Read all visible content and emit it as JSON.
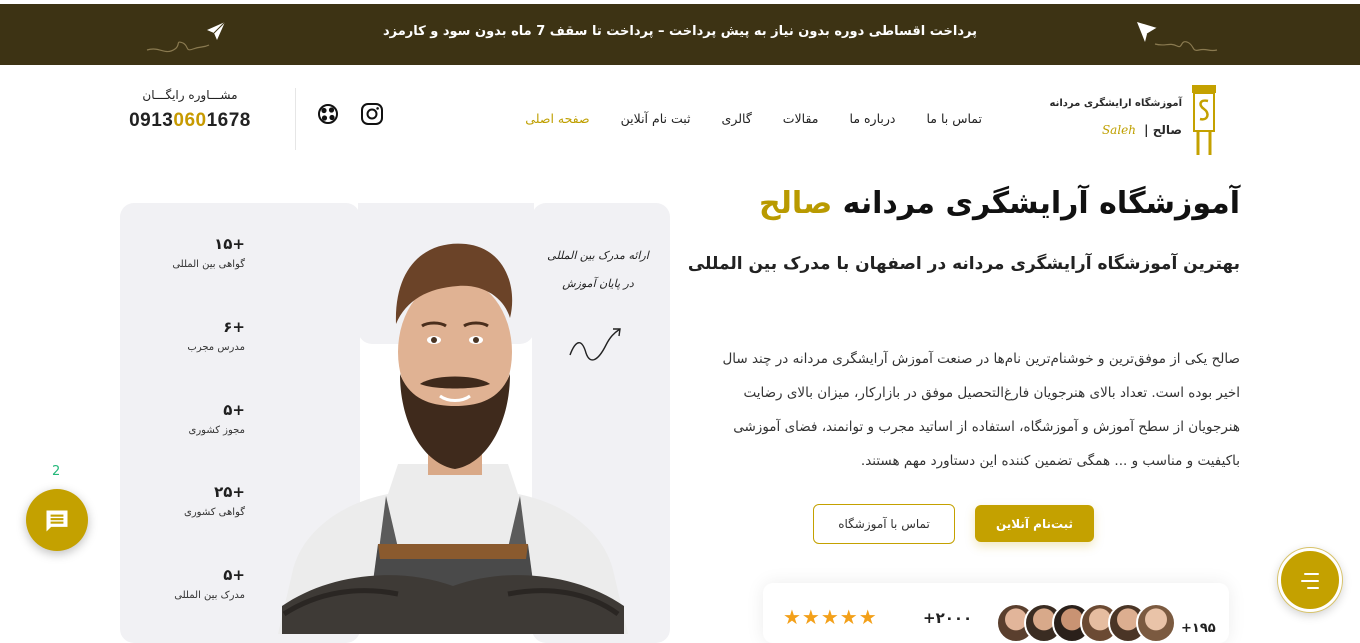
{
  "announcement": {
    "text": "پرداخت اقساطی دوره بدون نیاز به پیش پرداخت – پرداخت تا سقف 7 ماه بدون سود و کارمزد"
  },
  "logo": {
    "title": "آموزشگاه ارایشگری مردانه",
    "brand": "صالح |",
    "latin": "Saleh"
  },
  "nav": {
    "items": [
      {
        "label": "صفحه اصلی",
        "active": true
      },
      {
        "label": "ثبت نام آنلاین"
      },
      {
        "label": "گالری"
      },
      {
        "label": "مقالات"
      },
      {
        "label": "درباره ما"
      },
      {
        "label": "تماس با ما"
      }
    ]
  },
  "social": {
    "icons": [
      "instagram-icon",
      "aparat-icon"
    ]
  },
  "consultation": {
    "label": "مشـــاوره رایگـــان",
    "phone_prefix": "0913",
    "phone_highlight": "060",
    "phone_suffix": "1678"
  },
  "hero": {
    "title_prefix": "آموزشگاه آرایشگری مردانه ",
    "title_accent": "صالح",
    "subtitle": "بهترین آموزشگاه آرایشگری مردانه در اصفهان با مدرک بین المللی",
    "description": "صالح یکی از موفق‌ترین و خوشنام‌ترین نام‌ها در صنعت آموزش آرایشگری مردانه در چند سال اخیر بوده است. تعداد بالای هنرجویان فارغ‌التحصیل موفق در بازارکار، میزان بالای رضایت هنرجویان از سطح آموزش و آموزشگاه، استفاده از اساتید مجرب و توانمند، فضای آموزشی باکیفیت و مناسب و ... همگی تضمین کننده این دستاورد مهم هستند.",
    "primary_button": "ثبت‌نام آنلاین",
    "secondary_button": "تماس با آموزشگاه"
  },
  "stats": [
    {
      "value": "+۱۵",
      "label": "گواهی بین المللی"
    },
    {
      "value": "+۶",
      "label": "مدرس مجرب"
    },
    {
      "value": "+۵",
      "label": "مجوز کشوری"
    },
    {
      "value": "+۲۵",
      "label": "گواهی کشوری"
    },
    {
      "value": "+۵",
      "label": "مدرک بین المللی"
    }
  ],
  "certificate": {
    "line1": "ارائه مدرک بین المللی",
    "line2": "در پایان آموزش"
  },
  "rating": {
    "stars": "★★★★★",
    "star_count": 5,
    "students": "+۲۰۰۰",
    "instructors": "+۱۹۵"
  },
  "chat": {
    "badge": "2",
    "icon": "chat-icon"
  },
  "menu": {
    "icon": "menu-icon"
  },
  "colors": {
    "accent": "#c4a100",
    "topbar": "#3d3314",
    "panel": "#f1f1f4",
    "star": "#f3a019"
  }
}
